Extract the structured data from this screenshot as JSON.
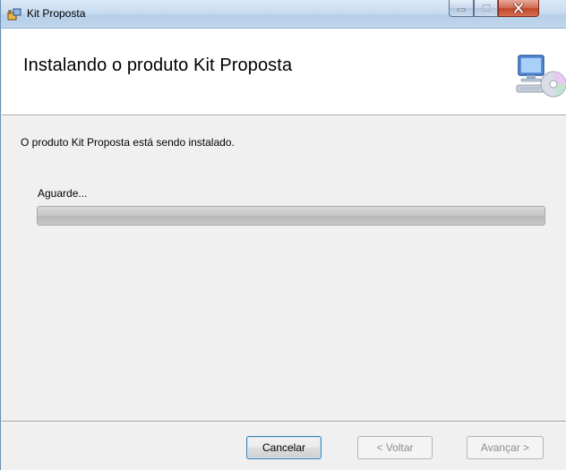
{
  "window": {
    "title": "Kit Proposta"
  },
  "banner": {
    "title": "Instalando o produto Kit Proposta"
  },
  "main": {
    "status_text": "O produto Kit Proposta está sendo instalado.",
    "wait_label": "Aguarde...",
    "progress_percent": 100
  },
  "footer": {
    "cancel_label": "Cancelar",
    "back_label": "< Voltar",
    "next_label": "Avançar >"
  },
  "icons": [
    "installer-app-icon",
    "minimize-icon",
    "maximize-icon",
    "close-icon",
    "computer-cd-icon"
  ],
  "colors": {
    "titlebar": "#c9dcf0",
    "close_button": "#c0462a",
    "progress": "#c8c8c8"
  }
}
